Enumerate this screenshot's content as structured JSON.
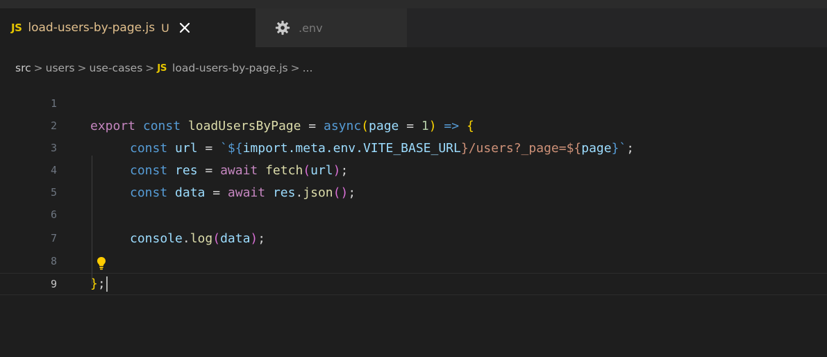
{
  "tabs": [
    {
      "badge": "JS",
      "title": "load-users-by-page.js",
      "modified": "U",
      "active": true
    },
    {
      "title": ".env",
      "active": false
    }
  ],
  "breadcrumb": {
    "segments": [
      "src",
      "users",
      "use-cases"
    ],
    "file_badge": "JS",
    "file": "load-users-by-page.js",
    "tail": "...",
    "separator": ">"
  },
  "editor": {
    "line_numbers": [
      "1",
      "2",
      "3",
      "4",
      "5",
      "6",
      "7",
      "8",
      "9"
    ],
    "active_line": "9",
    "lines": {
      "l2": {
        "export": "export",
        "const": "const",
        "name": "loadUsersByPage",
        "eq": " = ",
        "async": "async",
        "paren_open": "(",
        "param": "page",
        "param_eq": " = ",
        "default": "1",
        "paren_close": ")",
        "arrow": " => ",
        "brace_open": "{"
      },
      "l3": {
        "const": "const",
        "var": "url",
        "eq": " = ",
        "tick_open": "`${",
        "expr": "import.meta.env.VITE_BASE_URL",
        "mid": "}/users?_page=${",
        "param": "page",
        "tick_close": "}`",
        "semi": ";"
      },
      "l4": {
        "const": "const",
        "var": "res",
        "eq": " = ",
        "await": "await",
        "fn": "fetch",
        "paren_open": "(",
        "arg": "url",
        "paren_close": ")",
        "semi": ";"
      },
      "l5": {
        "const": "const",
        "var": "data",
        "eq": " = ",
        "await": "await",
        "obj": "res",
        "dot": ".",
        "fn": "json",
        "parens": "()",
        "semi": ";"
      },
      "l7": {
        "obj": "console",
        "dot": ".",
        "fn": "log",
        "paren_open": "(",
        "arg": "data",
        "paren_close": ")",
        "semi": ";"
      },
      "l9": {
        "brace_close": "}",
        "semi": ";"
      }
    }
  },
  "colors": {
    "background": "#1e1e1e",
    "tab_title_modified": "#e2c08d",
    "js_badge": "#e5c500",
    "keyword": "#569cd6",
    "control_keyword": "#c586c0",
    "function": "#dcdcaa",
    "variable": "#9cdcfe",
    "number": "#b5cea8",
    "string": "#ce9178"
  },
  "icons": {
    "close": "close-icon",
    "settings": "gear-icon",
    "lightbulb": "lightbulb-icon"
  }
}
